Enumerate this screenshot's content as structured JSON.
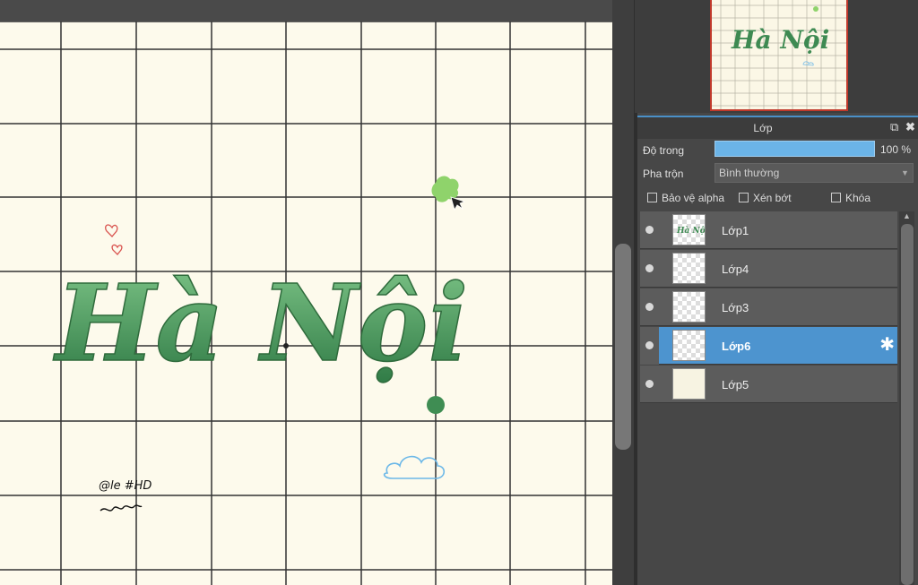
{
  "canvas": {
    "artwork_title": "Hà Nội",
    "signature": "@le #HD"
  },
  "layer_panel": {
    "title": "Lớp",
    "opacity_label": "Độ trong",
    "opacity_value": "100 %",
    "opacity_fraction": 1.0,
    "blend_label": "Pha trộn",
    "blend_value": "Bình thường",
    "protect_alpha_label": "Bảo vệ alpha",
    "clipping_label": "Xén bớt",
    "lock_label": "Khóa",
    "layers": [
      {
        "name": "Lớp1",
        "selected": false
      },
      {
        "name": "Lớp4",
        "selected": false
      },
      {
        "name": "Lớp3",
        "selected": false
      },
      {
        "name": "Lớp6",
        "selected": true
      },
      {
        "name": "Lớp5",
        "selected": false
      }
    ]
  },
  "icons": {
    "popout": "popout-icon",
    "close": "close-icon",
    "gear": "gear-icon",
    "eye": "eye-icon"
  },
  "colors": {
    "accent": "#4d94cf",
    "lettering": "#3e8a52",
    "paper": "#fdfaec"
  }
}
